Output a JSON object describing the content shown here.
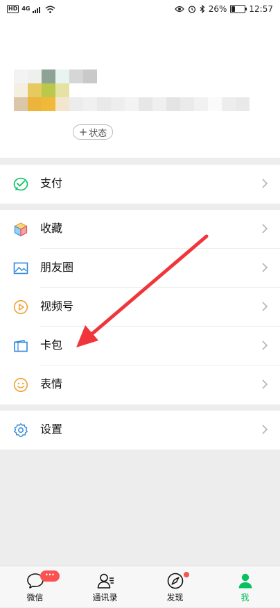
{
  "statusbar": {
    "hd": "HD",
    "network": "4G",
    "battery_text": "26%",
    "battery_level": 0.26,
    "time": "12:57"
  },
  "profile": {
    "status_button": "状态",
    "status_plus": "+"
  },
  "menu": {
    "pay": "支付",
    "favorites": "收藏",
    "moments": "朋友圈",
    "channels": "视频号",
    "cards": "卡包",
    "stickers": "表情",
    "settings": "设置"
  },
  "tabbar": {
    "chats": "微信",
    "chats_badge": "···",
    "contacts": "通讯录",
    "discover": "发现",
    "me": "我"
  },
  "colors": {
    "accent": "#07c160",
    "badge": "#fa5151",
    "annotation_arrow": "#f0353b"
  }
}
